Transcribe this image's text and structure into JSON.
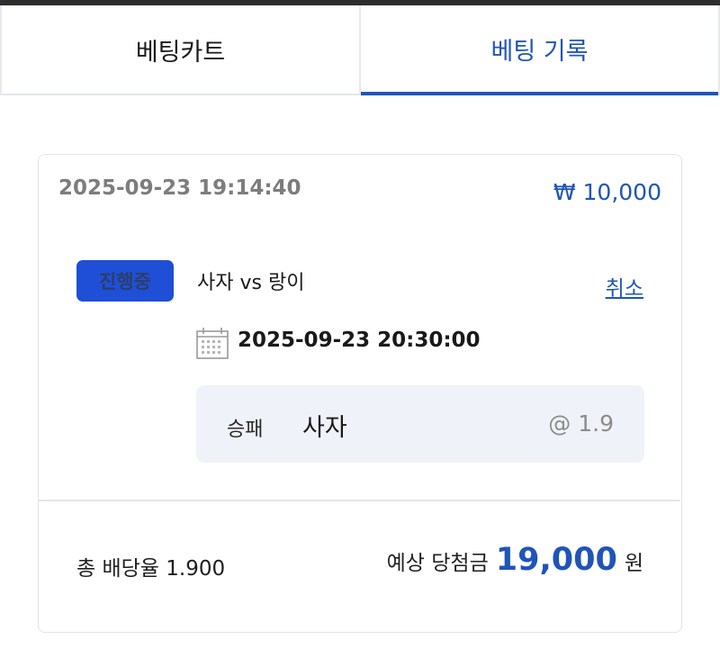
{
  "tabs": {
    "cart": "베팅카트",
    "history": "베팅 기록"
  },
  "bet": {
    "placed_at": "2025-09-23 19:14:40",
    "amount": "₩ 10,000",
    "status": "진행중",
    "match": "사자 vs 랑이",
    "cancel_label": "취소",
    "match_time": "2025-09-23 20:30:00",
    "pick_type": "승패",
    "pick_team": "사자",
    "pick_odds": "@ 1.9"
  },
  "summary": {
    "total_odds": "총 배당율 1.900",
    "payout_label": "예상 당첨금",
    "payout_value": "19,000",
    "payout_unit": "원"
  },
  "icons": {
    "calendar": "calendar-icon"
  },
  "colors": {
    "accent": "#1f55b8",
    "badge": "#1f4fd6",
    "pick_bg": "#eff2f8"
  }
}
